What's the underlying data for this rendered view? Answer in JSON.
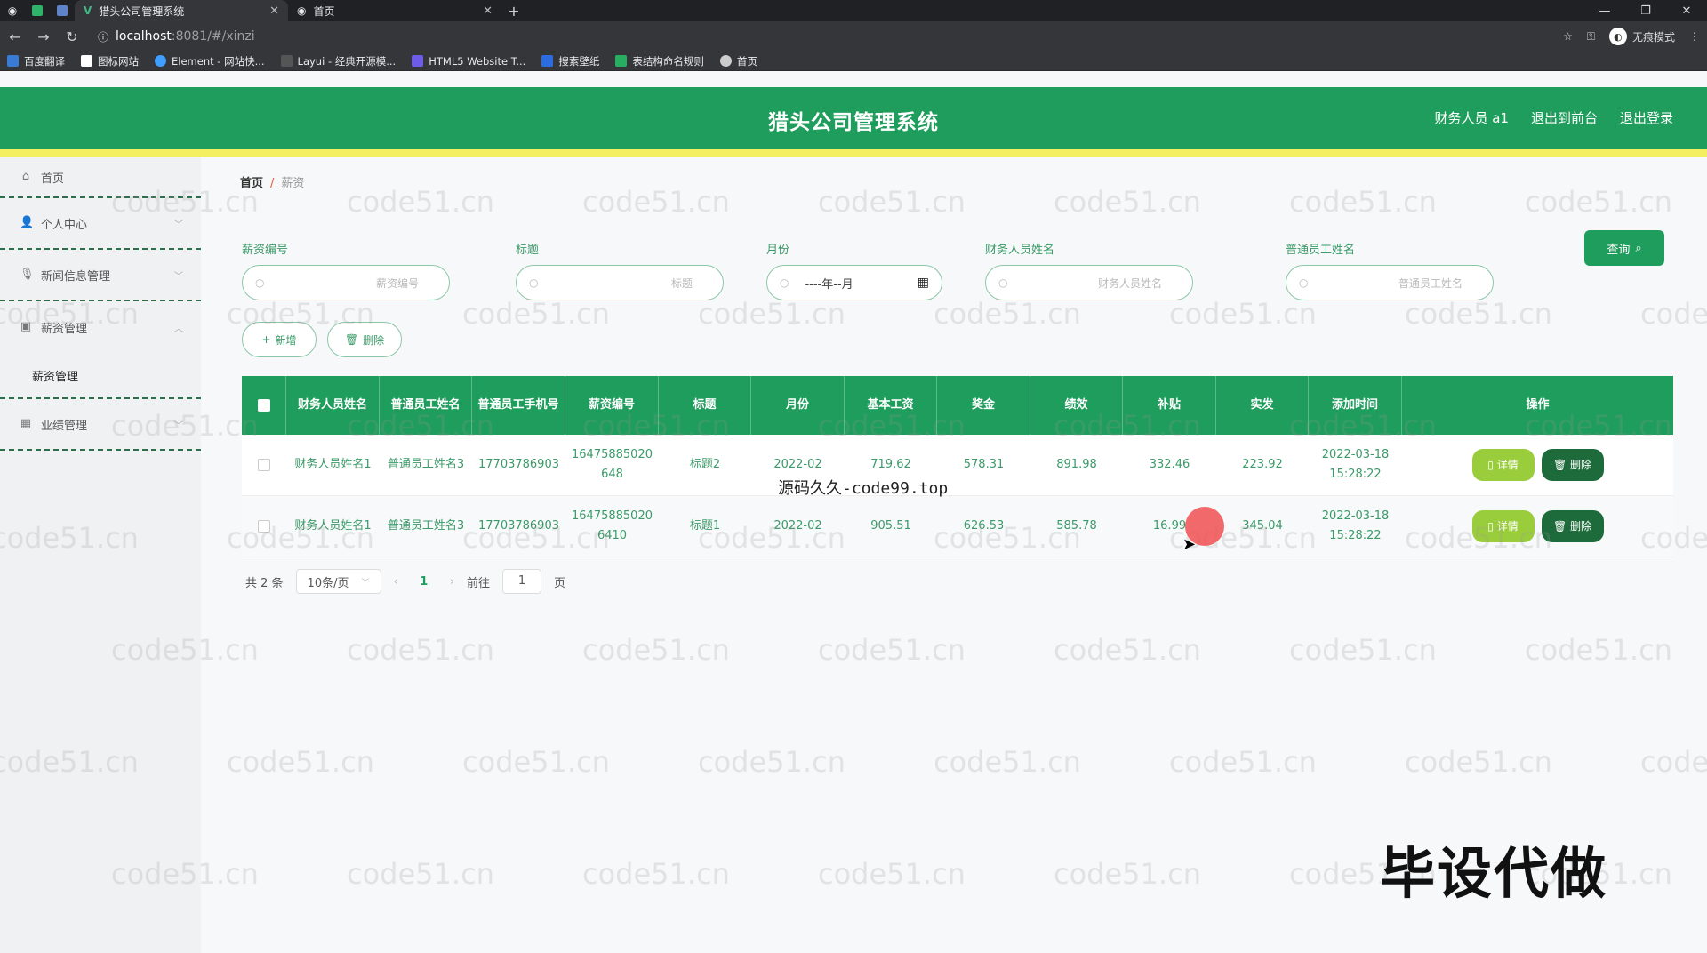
{
  "browser": {
    "tabs": [
      {
        "title": "猎头公司管理系统",
        "active": true
      },
      {
        "title": "首页",
        "active": false
      }
    ],
    "url_host": "localhost",
    "url_path": ":8081/#/xinzi",
    "incognito_label": "无痕模式",
    "bookmarks": [
      "百度翻译",
      "图标网站",
      "Element - 网站快...",
      "Layui - 经典开源模...",
      "HTML5 Website T...",
      "搜索壁纸",
      "表结构命名规则",
      "首页"
    ]
  },
  "header": {
    "title": "猎头公司管理系统",
    "user": "财务人员 a1",
    "back_front": "退出到前台",
    "logout": "退出登录"
  },
  "sidebar": {
    "items": [
      {
        "label": "首页",
        "icon": "home-icon"
      },
      {
        "label": "个人中心",
        "icon": "user-icon"
      },
      {
        "label": "新闻信息管理",
        "icon": "mic-icon"
      },
      {
        "label": "薪资管理",
        "icon": "briefcase-icon"
      },
      {
        "label": "业绩管理",
        "icon": "calendar-icon"
      }
    ],
    "sub_item": "薪资管理"
  },
  "breadcrumb": {
    "home": "首页",
    "sep": "/",
    "current": "薪资"
  },
  "filters": {
    "salary_no": {
      "label": "薪资编号",
      "placeholder": "薪资编号"
    },
    "title": {
      "label": "标题",
      "placeholder": "标题"
    },
    "month": {
      "label": "月份",
      "placeholder": "----年--月"
    },
    "finance_name": {
      "label": "财务人员姓名",
      "placeholder": "财务人员姓名"
    },
    "employee_name": {
      "label": "普通员工姓名",
      "placeholder": "普通员工姓名"
    },
    "query_button": "查询"
  },
  "actions": {
    "add": "新增",
    "delete": "删除"
  },
  "table": {
    "headers": [
      "财务人员姓名",
      "普通员工姓名",
      "普通员工手机号",
      "薪资编号",
      "标题",
      "月份",
      "基本工资",
      "奖金",
      "绩效",
      "补贴",
      "实发",
      "添加时间",
      "操作"
    ],
    "rows": [
      [
        "财务人员姓名1",
        "普通员工姓名3",
        "17703786903",
        "16475885020648",
        "标题2",
        "2022-02",
        "719.62",
        "578.31",
        "891.98",
        "332.46",
        "223.92",
        "2022-03-18 15:28:22"
      ],
      [
        "财务人员姓名1",
        "普通员工姓名3",
        "17703786903",
        "164758850206410",
        "标题1",
        "2022-02",
        "905.51",
        "626.53",
        "585.78",
        "16.99",
        "345.04",
        "2022-03-18 15:28:22"
      ]
    ],
    "detail_button": "详情",
    "delete_button": "删除"
  },
  "pagination": {
    "total": "共 2 条",
    "page_size": "10条/页",
    "current_page": "1",
    "goto_prefix": "前往",
    "goto_value": "1",
    "goto_suffix": "页"
  },
  "overlay": {
    "source_text": "源码久久-code99.top",
    "big_text": "毕设代做",
    "watermark": "code51.cn"
  },
  "colors": {
    "primary": "#1f9d5c",
    "accent_yellow": "#f4ef60",
    "detail_btn": "#9acd3c",
    "delete_btn": "#1d6b3a"
  }
}
